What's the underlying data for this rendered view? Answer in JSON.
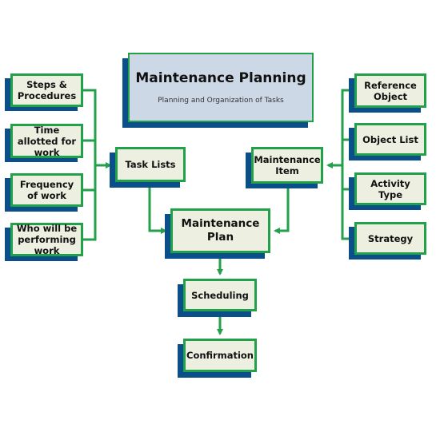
{
  "title": {
    "main": "Maintenance Planning",
    "subtitle": "Planning and Organization of Tasks"
  },
  "left_items": [
    "Steps & Procedures",
    "Time allotted for work",
    "Frequency of work",
    "Who will be performing work"
  ],
  "task_lists": "Task Lists",
  "maintenance_item": "Maintenance Item",
  "right_items": [
    "Reference Object",
    "Object List",
    "Activity Type",
    "Strategy"
  ],
  "maintenance_plan": "Maintenance Plan",
  "scheduling": "Scheduling",
  "confirmation": "Confirmation",
  "colors": {
    "box_fill": "#edf0e1",
    "border_green": "#22a04a",
    "shadow_blue": "#0b4f8a",
    "title_fill": "#ccd8e6"
  }
}
